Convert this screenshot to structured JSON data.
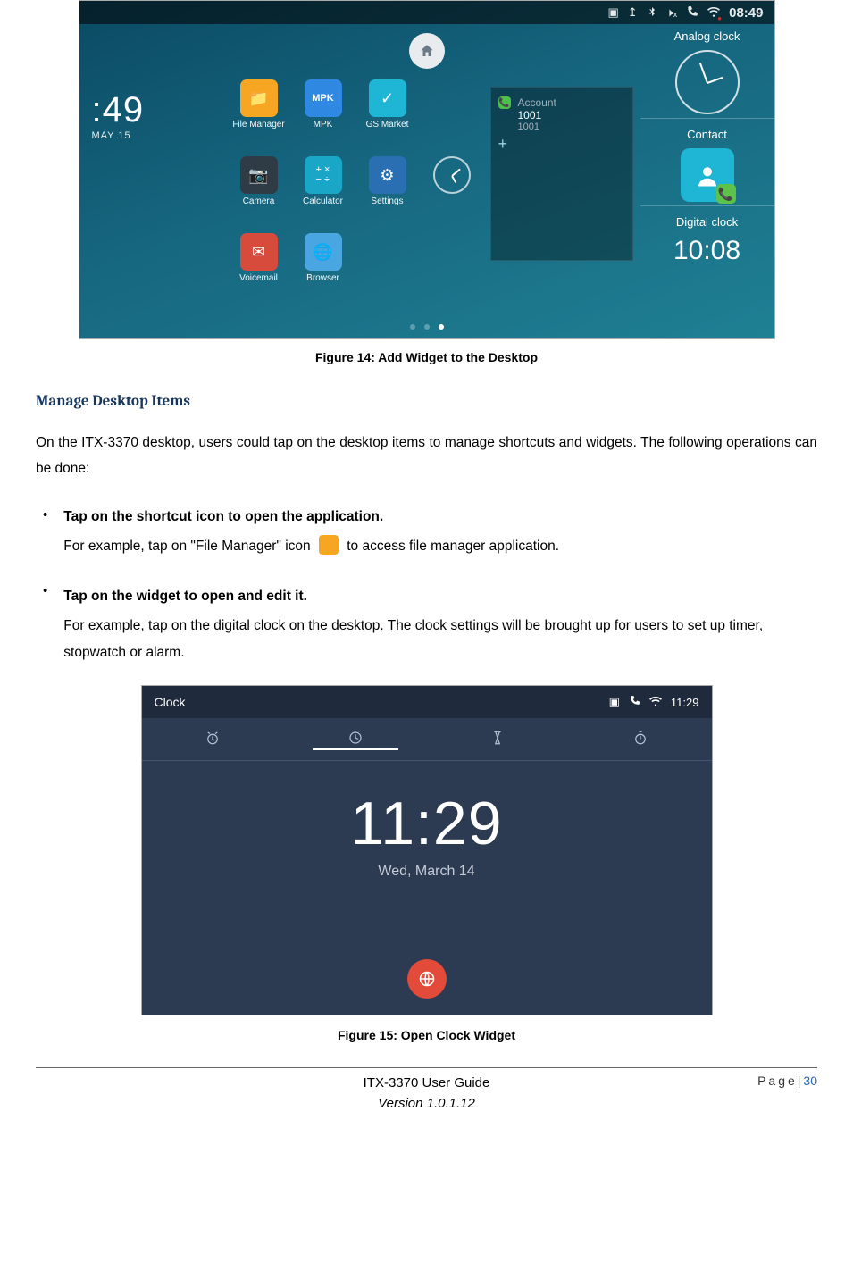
{
  "figure1": {
    "statusbar": {
      "time": "08:49"
    },
    "left_clock": {
      "time": ":49",
      "date": "MAY 15"
    },
    "apps": {
      "file_manager": "File Manager",
      "mpk": "MPK",
      "gs_market": "GS Market",
      "camera": "Camera",
      "calculator": "Calculator",
      "settings": "Settings",
      "voicemail": "Voicemail",
      "browser": "Browser"
    },
    "account": {
      "header": "Account",
      "number": "1001",
      "sub": "1001"
    },
    "widgets": {
      "analog": "Analog clock",
      "contact": "Contact",
      "digital": "Digital clock",
      "digital_time": "10:08"
    },
    "caption": "Figure 14: Add Widget to the Desktop"
  },
  "section_heading": "Manage Desktop Items",
  "intro": "On the ITX-3370 desktop, users could tap on the desktop items to manage shortcuts and widgets. The following operations can be done:",
  "bullet1": {
    "title": "Tap on the shortcut icon to open the application.",
    "pre": "For example, tap on \"File Manager\" icon ",
    "post": " to access file manager application."
  },
  "bullet2": {
    "title": "Tap on the widget to open and edit it.",
    "body": "For example, tap on the digital clock on the desktop. The clock settings will be brought up for users to set up timer, stopwatch or alarm."
  },
  "figure2": {
    "title": "Clock",
    "status_time": "11:29",
    "big_time": "11:29",
    "big_date": "Wed, March 14",
    "caption": "Figure 15: Open Clock Widget"
  },
  "footer": {
    "guide": "ITX-3370 User Guide",
    "version": "Version 1.0.1.12",
    "page_label": "Page|",
    "page_no": "30"
  }
}
